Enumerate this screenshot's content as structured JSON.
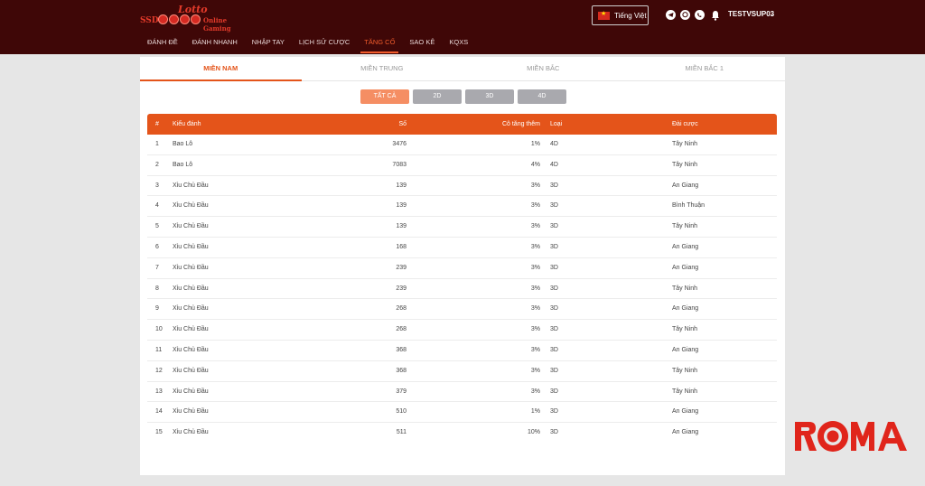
{
  "header": {
    "logo": {
      "top": "Lotto",
      "left": "SSD",
      "sub": "Online Gaming"
    },
    "language": "Tiếng Việt",
    "username": "TESTVSUP03",
    "social_icons": [
      "telegram-icon",
      "viber-icon",
      "whatsapp-icon"
    ],
    "bg_color": "#3f0707"
  },
  "nav": {
    "items": [
      "ĐÁNH ĐỀ",
      "ĐÁNH NHANH",
      "NHẬP TAY",
      "LỊCH SỬ CƯỢC",
      "TĂNG CỐ",
      "SAO KÊ",
      "KQXS"
    ],
    "active_index": 4
  },
  "regions": {
    "tabs": [
      "MIỀN NAM",
      "MIỀN TRUNG",
      "MIỀN BẮC",
      "MIỀN BẮC 1"
    ],
    "active_index": 0
  },
  "filters": {
    "buttons": [
      "TẤT CẢ",
      "2D",
      "3D",
      "4D"
    ],
    "active_index": 0
  },
  "table": {
    "headers": {
      "idx": "#",
      "type": "Kiểu đánh",
      "number": "Số",
      "pct": "Cô tăng thêm",
      "kind": "Loại",
      "station": "Đài cược"
    },
    "rows": [
      {
        "idx": "1",
        "type": "Bao Lô",
        "number": "3476",
        "pct": "1%",
        "kind": "4D",
        "station": "Tây Ninh"
      },
      {
        "idx": "2",
        "type": "Bao Lô",
        "number": "7083",
        "pct": "4%",
        "kind": "4D",
        "station": "Tây Ninh"
      },
      {
        "idx": "3",
        "type": "Xỉu Chủ Đầu",
        "number": "139",
        "pct": "3%",
        "kind": "3D",
        "station": "An Giang"
      },
      {
        "idx": "4",
        "type": "Xỉu Chủ Đầu",
        "number": "139",
        "pct": "3%",
        "kind": "3D",
        "station": "Bình Thuận"
      },
      {
        "idx": "5",
        "type": "Xỉu Chủ Đầu",
        "number": "139",
        "pct": "3%",
        "kind": "3D",
        "station": "Tây Ninh"
      },
      {
        "idx": "6",
        "type": "Xỉu Chủ Đầu",
        "number": "168",
        "pct": "3%",
        "kind": "3D",
        "station": "An Giang"
      },
      {
        "idx": "7",
        "type": "Xỉu Chủ Đầu",
        "number": "239",
        "pct": "3%",
        "kind": "3D",
        "station": "An Giang"
      },
      {
        "idx": "8",
        "type": "Xỉu Chủ Đầu",
        "number": "239",
        "pct": "3%",
        "kind": "3D",
        "station": "Tây Ninh"
      },
      {
        "idx": "9",
        "type": "Xỉu Chủ Đầu",
        "number": "268",
        "pct": "3%",
        "kind": "3D",
        "station": "An Giang"
      },
      {
        "idx": "10",
        "type": "Xỉu Chủ Đầu",
        "number": "268",
        "pct": "3%",
        "kind": "3D",
        "station": "Tây Ninh"
      },
      {
        "idx": "11",
        "type": "Xỉu Chủ Đầu",
        "number": "368",
        "pct": "3%",
        "kind": "3D",
        "station": "An Giang"
      },
      {
        "idx": "12",
        "type": "Xỉu Chủ Đầu",
        "number": "368",
        "pct": "3%",
        "kind": "3D",
        "station": "Tây Ninh"
      },
      {
        "idx": "13",
        "type": "Xỉu Chủ Đầu",
        "number": "379",
        "pct": "3%",
        "kind": "3D",
        "station": "Tây Ninh"
      },
      {
        "idx": "14",
        "type": "Xỉu Chủ Đầu",
        "number": "510",
        "pct": "1%",
        "kind": "3D",
        "station": "An Giang"
      },
      {
        "idx": "15",
        "type": "Xỉu Chủ Đầu",
        "number": "511",
        "pct": "10%",
        "kind": "3D",
        "station": "An Giang"
      }
    ]
  },
  "watermark": {
    "text": "ROMA",
    "color": "#e0251b"
  }
}
